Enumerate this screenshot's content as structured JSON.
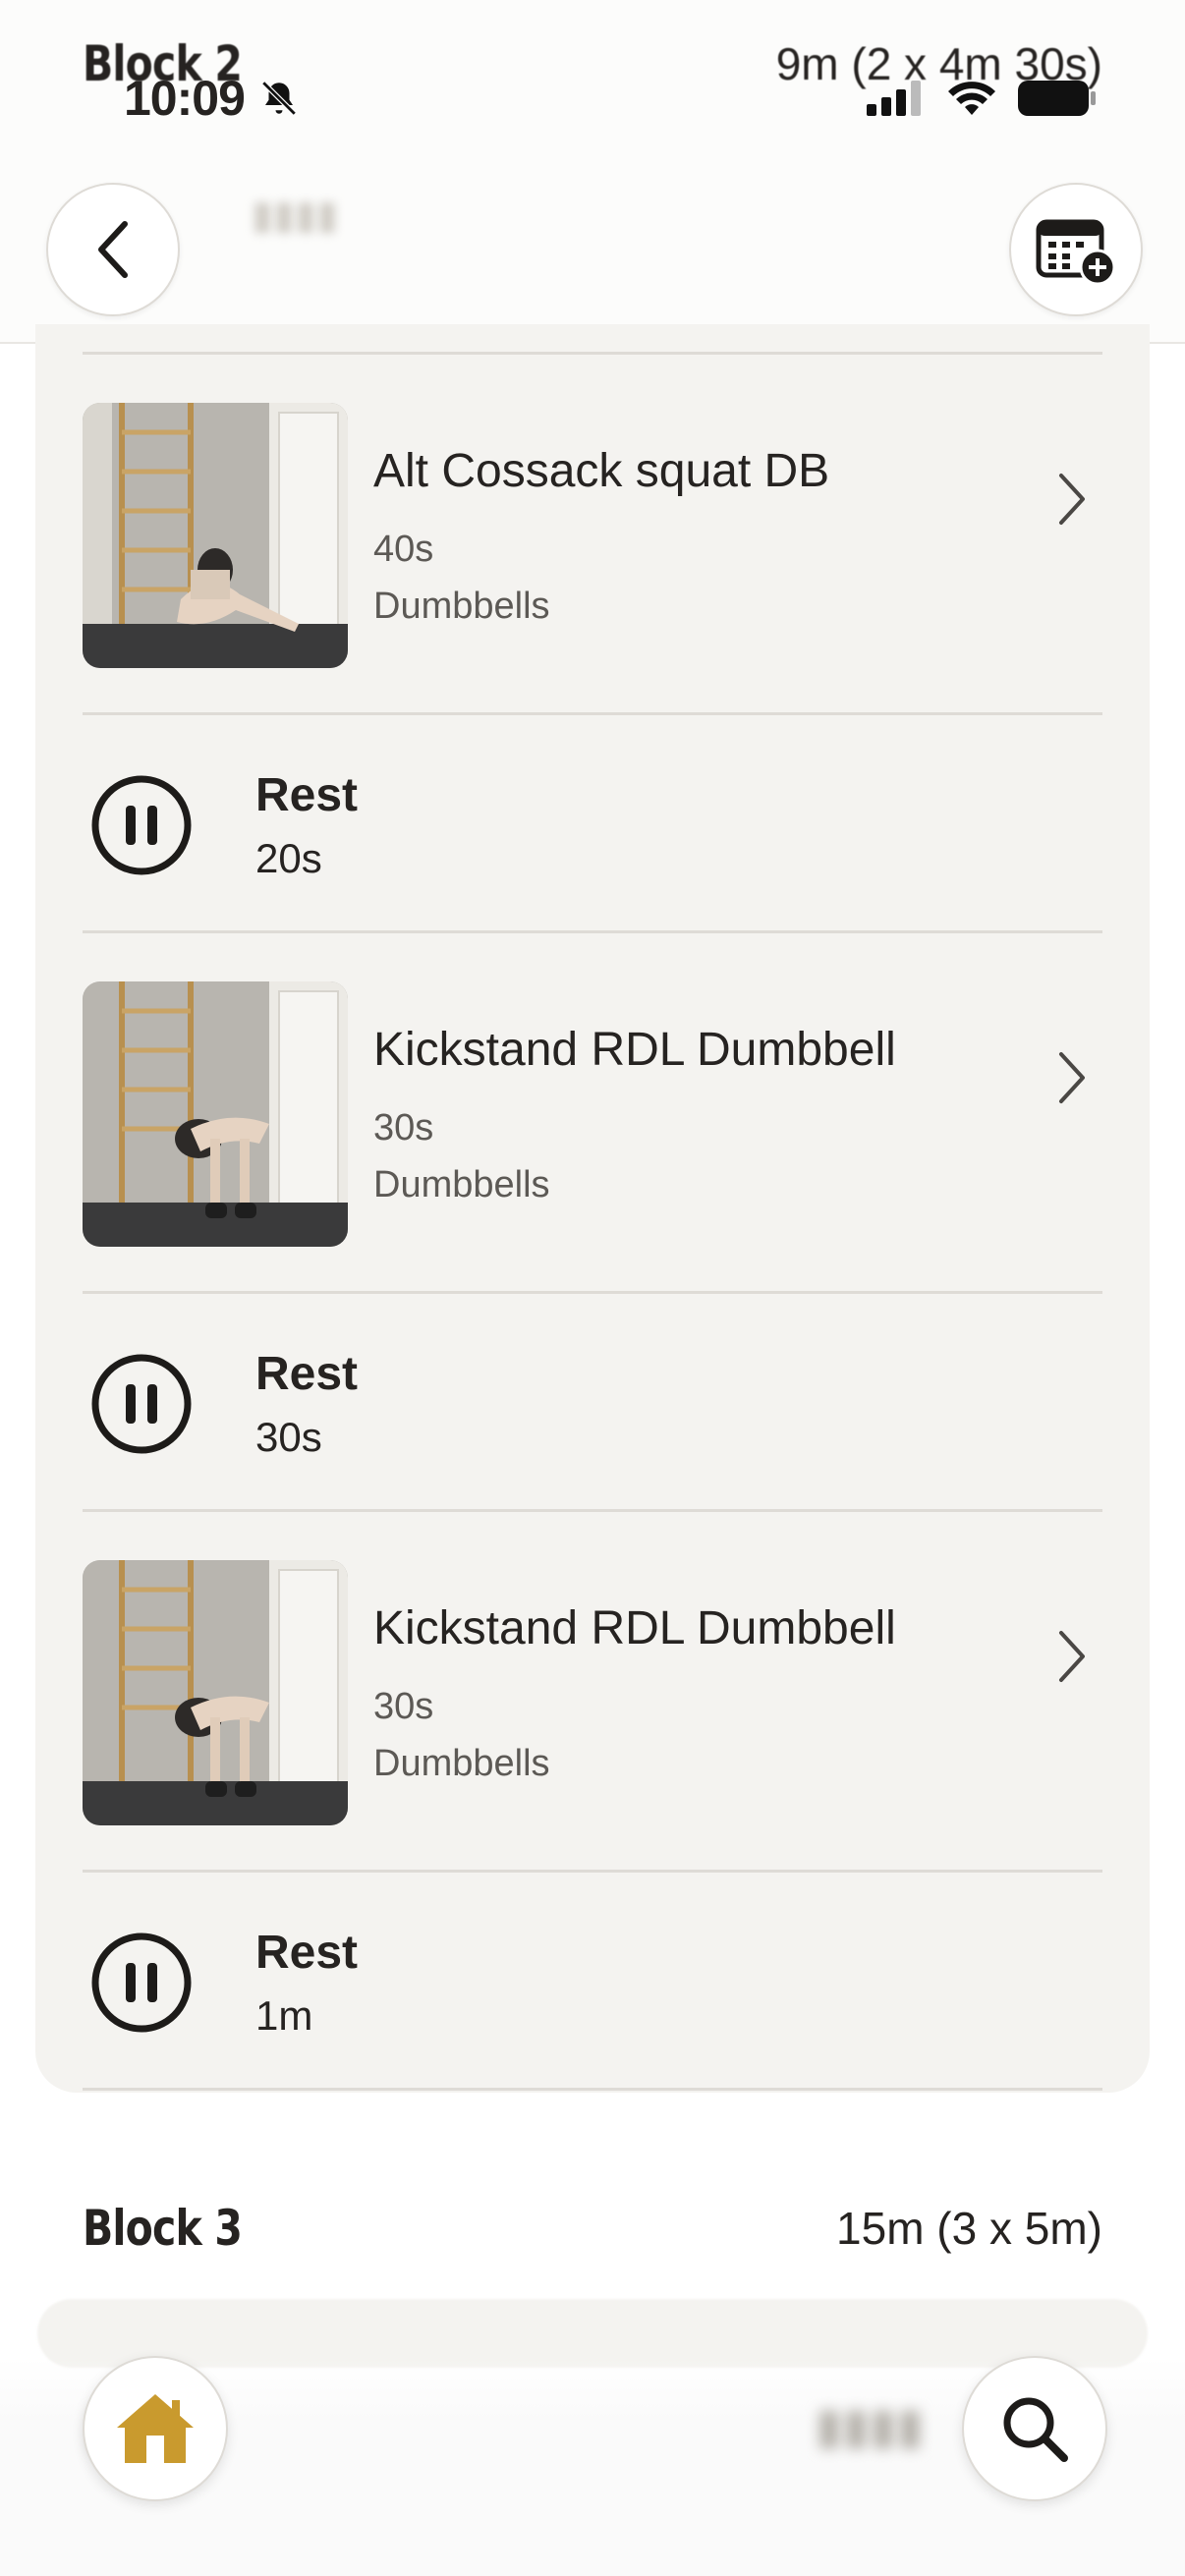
{
  "status_bar": {
    "time": "10:09"
  },
  "block2": {
    "title": "Block 2",
    "duration": "9m (2 x 4m 30s)"
  },
  "exercises": [
    {
      "name": "Alt Cossack squat DB",
      "time": "40s",
      "equipment": "Dumbbells"
    },
    {
      "name": "Kickstand RDL Dumbbell",
      "time": "30s",
      "equipment": "Dumbbells"
    },
    {
      "name": "Kickstand RDL Dumbbell",
      "time": "30s",
      "equipment": "Dumbbells"
    }
  ],
  "rests": [
    {
      "label": "Rest",
      "time": "20s"
    },
    {
      "label": "Rest",
      "time": "30s"
    },
    {
      "label": "Rest",
      "time": "1m"
    }
  ],
  "block3": {
    "title": "Block 3",
    "duration": "15m (3 x 5m)"
  },
  "icons": {
    "back": "chevron-left-icon",
    "calendar": "calendar-add-icon",
    "home": "home-icon",
    "search": "search-icon",
    "pause": "pause-circle-icon",
    "chevron": "chevron-right-icon"
  },
  "colors": {
    "accent": "#c99a2e",
    "card_bg": "#f4f3f0",
    "text": "#262321"
  }
}
